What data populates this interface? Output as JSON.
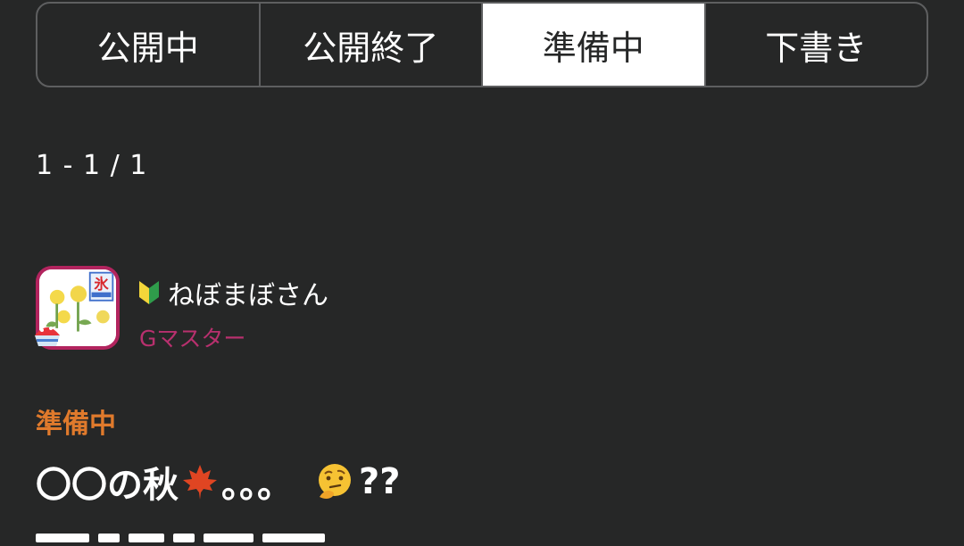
{
  "tabs": [
    {
      "label": "公開中",
      "active": false
    },
    {
      "label": "公開終了",
      "active": false
    },
    {
      "label": "準備中",
      "active": true
    },
    {
      "label": "下書き",
      "active": false
    }
  ],
  "pagination": {
    "range": "1 - 1 / 1"
  },
  "author": {
    "name": "ねぼまぼさん",
    "rank": "Gマスター",
    "badge_icon": "beginner-mark-icon",
    "avatar_icon": "flower-avatar",
    "avatar_badge_icon": "shaved-ice-icon"
  },
  "post": {
    "status": "準備中",
    "title_text": "〇〇の秋",
    "title_suffix": "。。。",
    "title_end": "??",
    "icons": [
      "maple-leaf-icon",
      "thinking-face-icon"
    ]
  },
  "colors": {
    "background": "#262727",
    "tab_border": "#5e5f60",
    "active_tab_bg": "#ffffff",
    "rank": "#b8306e",
    "status": "#e07a2c",
    "avatar_border": "#b2245e"
  }
}
